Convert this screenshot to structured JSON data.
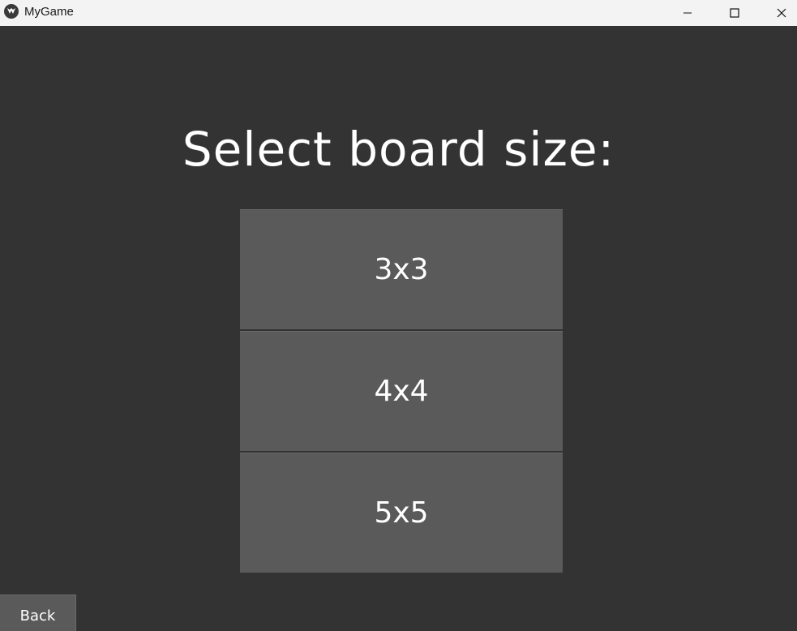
{
  "window": {
    "title": "MyGame",
    "icon": "kivy-logo-icon",
    "controls": [
      "minimize-icon",
      "maximize-icon",
      "close-icon"
    ]
  },
  "screen": {
    "heading": "Select board size:",
    "options": [
      {
        "label": "3x3"
      },
      {
        "label": "4x4"
      },
      {
        "label": "5x5"
      }
    ],
    "back_label": "Back"
  },
  "colors": {
    "background": "#333333",
    "button": "#5a5a5a",
    "text": "#ffffff",
    "titlebar": "#f3f3f3"
  }
}
